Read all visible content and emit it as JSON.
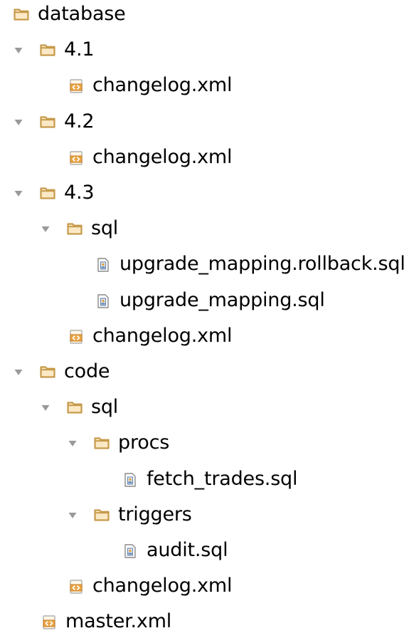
{
  "colors": {
    "folder": "#c69a4a",
    "folder_fill": "#fbe9c6",
    "arrow": "#9a9a9a",
    "xml_file": "#e8a646",
    "xml_file_dark": "#c47a1d",
    "sql_file": "#6c8ab5",
    "text": "#000000"
  },
  "tree": [
    {
      "label": "database",
      "type": "folder",
      "depth": 0,
      "expandable": false
    },
    {
      "label": "4.1",
      "type": "folder",
      "depth": 1,
      "expandable": true,
      "expanded": true
    },
    {
      "label": "changelog.xml",
      "type": "xml",
      "depth": 2
    },
    {
      "label": "4.2",
      "type": "folder",
      "depth": 1,
      "expandable": true,
      "expanded": true
    },
    {
      "label": "changelog.xml",
      "type": "xml",
      "depth": 2
    },
    {
      "label": "4.3",
      "type": "folder",
      "depth": 1,
      "expandable": true,
      "expanded": true
    },
    {
      "label": "sql",
      "type": "folder",
      "depth": 2,
      "expandable": true,
      "expanded": true
    },
    {
      "label": "upgrade_mapping.rollback.sql",
      "type": "sql",
      "depth": 3
    },
    {
      "label": "upgrade_mapping.sql",
      "type": "sql",
      "depth": 3
    },
    {
      "label": "changelog.xml",
      "type": "xml",
      "depth": 2
    },
    {
      "label": "code",
      "type": "folder",
      "depth": 1,
      "expandable": true,
      "expanded": true
    },
    {
      "label": "sql",
      "type": "folder",
      "depth": 2,
      "expandable": true,
      "expanded": true
    },
    {
      "label": "procs",
      "type": "folder",
      "depth": 3,
      "expandable": true,
      "expanded": true
    },
    {
      "label": "fetch_trades.sql",
      "type": "sql",
      "depth": 4
    },
    {
      "label": "triggers",
      "type": "folder",
      "depth": 3,
      "expandable": true,
      "expanded": true
    },
    {
      "label": "audit.sql",
      "type": "sql",
      "depth": 4
    },
    {
      "label": "changelog.xml",
      "type": "xml",
      "depth": 2
    },
    {
      "label": "master.xml",
      "type": "xml",
      "depth": 1
    }
  ]
}
